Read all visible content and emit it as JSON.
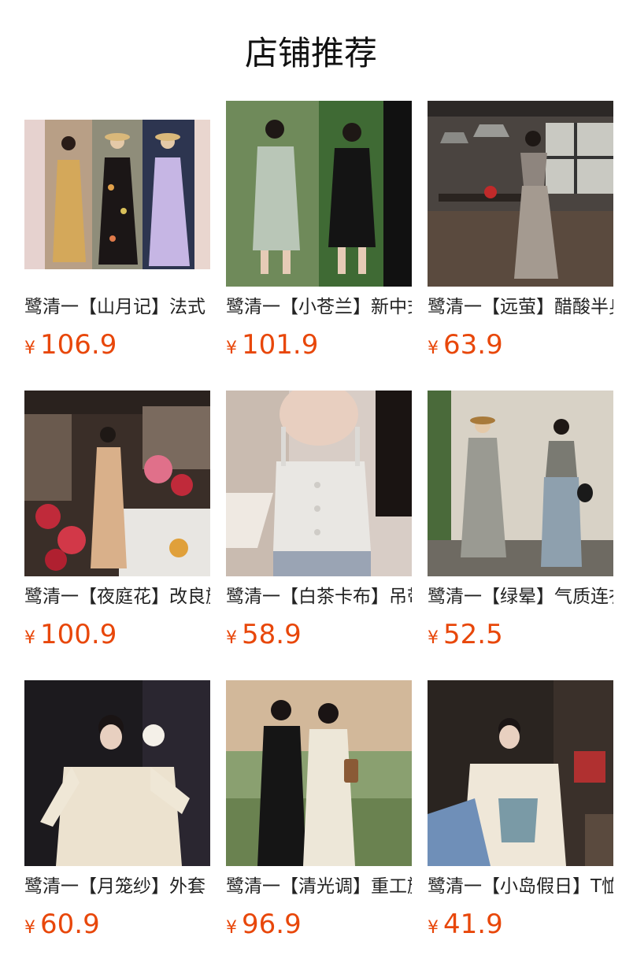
{
  "header": {
    "title": "店铺推荐"
  },
  "colors": {
    "price": "#e8470a",
    "title": "#111111"
  },
  "products": [
    {
      "name": "鹭清一【山月记】法式",
      "currency": "¥",
      "price": "106.9",
      "image": "three-models-floral-dresses-photo"
    },
    {
      "name": "鹭清一【小苍兰】新中式",
      "currency": "¥",
      "price": "101.9",
      "image": "two-models-qipao-photo"
    },
    {
      "name": "鹭清一【远萤】醋酸半身裙",
      "currency": "¥",
      "price": "63.9",
      "image": "model-restaurant-satin-skirt-photo"
    },
    {
      "name": "鹭清一【夜庭花】改良旗袍",
      "currency": "¥",
      "price": "100.9",
      "image": "model-flower-table-qipao-photo"
    },
    {
      "name": "鹭清一【白茶卡布】吊带",
      "currency": "¥",
      "price": "58.9",
      "image": "white-jacquard-camisole-photo"
    },
    {
      "name": "鹭清一【绿晕】气质连衣裙",
      "currency": "¥",
      "price": "52.5",
      "image": "two-models-green-print-photo"
    },
    {
      "name": "鹭清一【月笼纱】外套",
      "currency": "¥",
      "price": "60.9",
      "image": "model-cream-blouse-selfie-photo"
    },
    {
      "name": "鹭清一【清光调】重工旗袍",
      "currency": "¥",
      "price": "96.9",
      "image": "two-models-black-white-qipao-photo"
    },
    {
      "name": "鹭清一【小岛假日】T恤",
      "currency": "¥",
      "price": "41.9",
      "image": "model-printed-tshirt-photo"
    }
  ]
}
